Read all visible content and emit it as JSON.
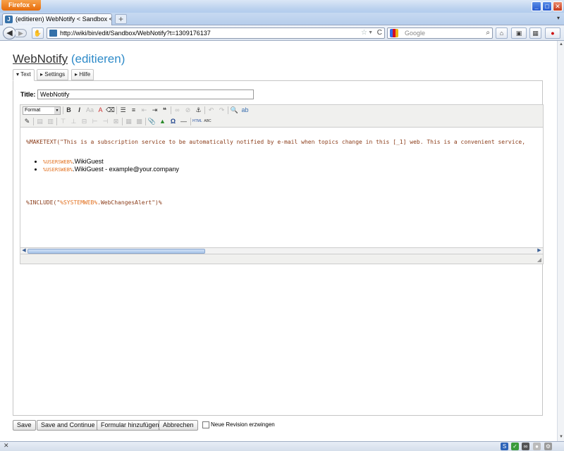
{
  "browser": {
    "menu_button": "Firefox",
    "tab_title": "(editieren) WebNotify < Sandbox < JAQUET...",
    "new_tab": "+",
    "url": "http://wiki/bin/edit/Sandbox/WebNotify?t=1309176137",
    "search_placeholder": "Google",
    "controls": {
      "minimize": "_",
      "maximize": "□",
      "close": "✕"
    }
  },
  "page": {
    "topic": "WebNotify",
    "edit_label": "(editieren)",
    "tabs": [
      {
        "label": "▾ Text",
        "active": true
      },
      {
        "label": "▸ Settings",
        "active": false
      },
      {
        "label": "▸ Hilfe",
        "active": false
      }
    ],
    "title_label": "Title:",
    "title_value": "WebNotify",
    "format_label": "Format"
  },
  "editor": {
    "line1_macro": "%MAKETEXT(\"This is a subscription service to be automatically notified by e-mail when topics change in this [_1] web. This is a convenient service,",
    "bullets": [
      {
        "var": "%USERSWEB%",
        "text": ".WikiGuest"
      },
      {
        "var": "%USERSWEB%",
        "text": ".WikiGuest - example@your.company"
      }
    ],
    "include_prefix": "%INCLUDE(\"",
    "include_var": "%SYSTEMWEB%",
    "include_suffix": ".WebChangesAlert\")%"
  },
  "actions": {
    "save": "Save",
    "save_continue": "Save and Continue",
    "add_form": "Formular hinzufügen",
    "cancel": "Abbrechen",
    "force_revision": "Neue Revision erzwingen"
  },
  "icons": {
    "back": "back-arrow-icon",
    "forward": "forward-arrow-icon",
    "home": "home-icon",
    "bookmark_star": "star-icon",
    "reload": "reload-icon",
    "search": "search-icon"
  },
  "colors": {
    "edit_link": "#2f8bc9",
    "macro_text": "#8b3d1a",
    "variable_text": "#e27222",
    "firefox_button": "#e66c0b"
  }
}
